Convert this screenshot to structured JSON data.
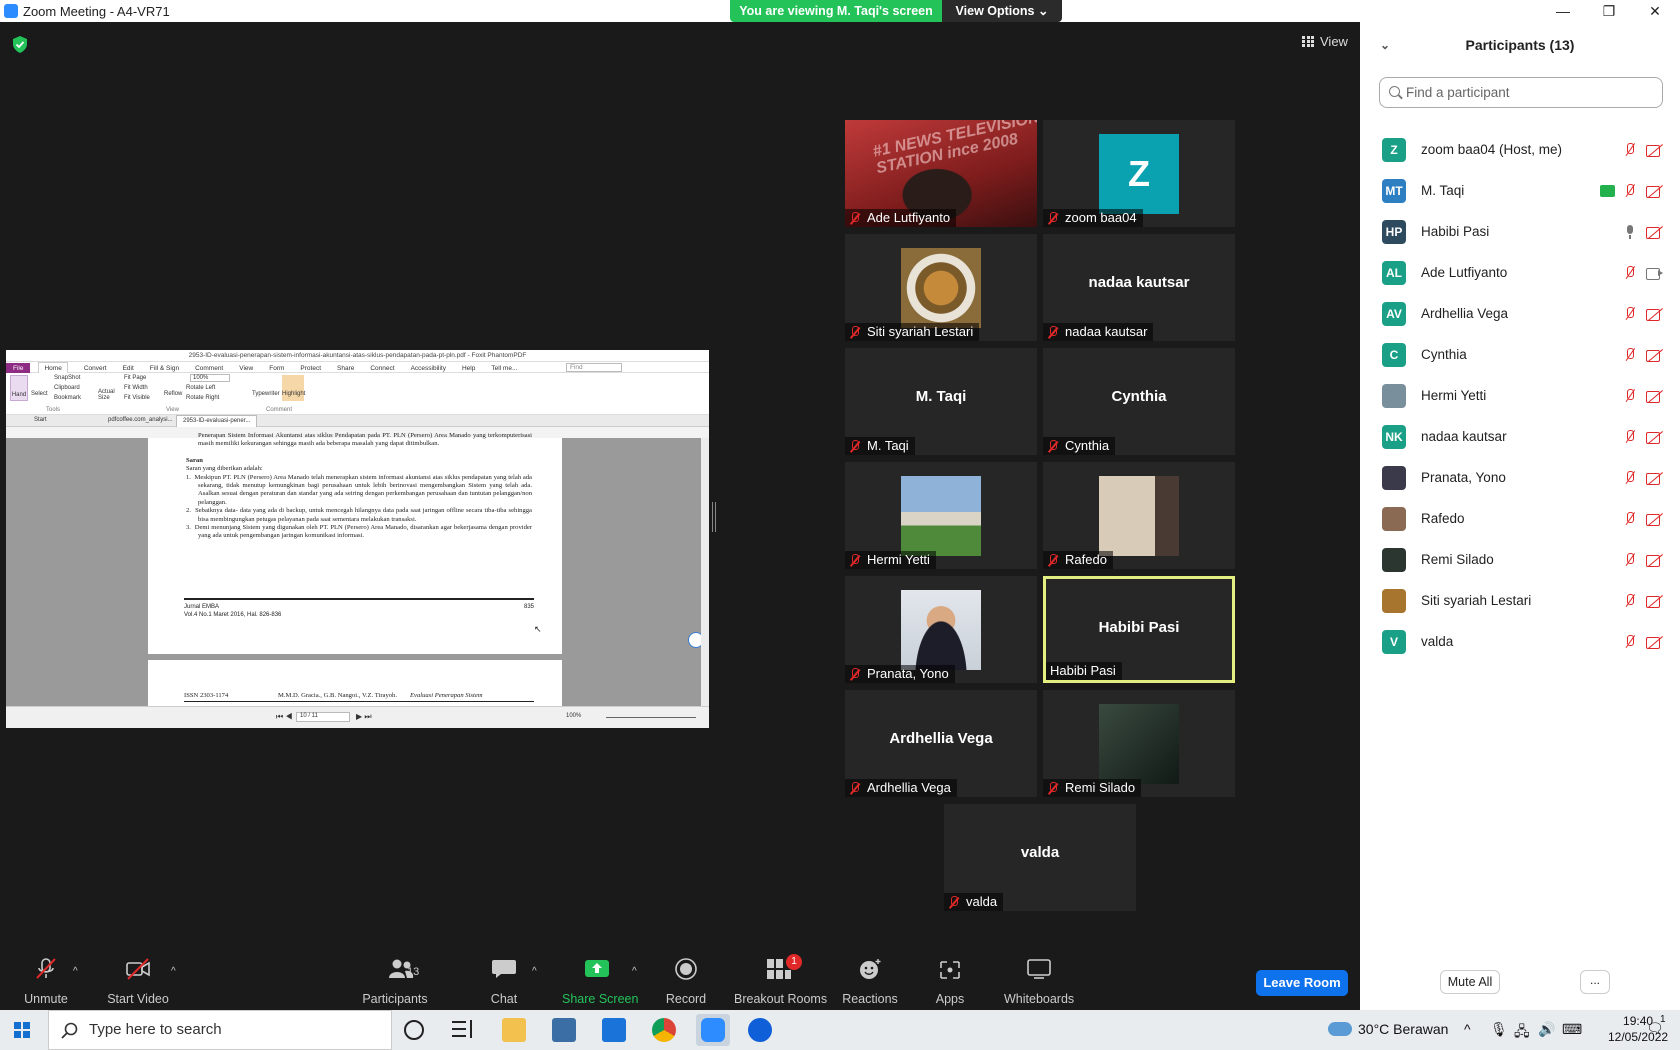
{
  "window": {
    "title": "Zoom Meeting - A4-VR71",
    "minimize": "—",
    "maximize": "❐",
    "close": "✕"
  },
  "banner": {
    "viewing": "You are viewing M. Taqi's screen",
    "view_options": "View Options ⌄"
  },
  "view_button": "View",
  "shared_screen": {
    "title": "2953-ID-evaluasi-penerapan-sistem-informasi-akuntansi-atas-siklus-pendapatan-pada-pt-pln.pdf - Foxit PhantomPDF",
    "menu": [
      "File",
      "Home",
      "Convert",
      "Edit",
      "Fill & Sign",
      "Comment",
      "View",
      "Form",
      "Protect",
      "Share",
      "Connect",
      "Accessibility",
      "Help",
      "Tell me..."
    ],
    "find_placeholder": "Find",
    "ribbon": {
      "hand": "Hand",
      "select": "Select",
      "snapshot": "SnapShot",
      "clipboard": "Clipboard",
      "bookmark": "Bookmark",
      "actual_size": "Actual Size",
      "fit_page": "Fit Page",
      "fit_width": "Fit Width",
      "fit_visible": "Fit Visible",
      "reflow": "Reflow",
      "zoom": "100%",
      "rotate_left": "Rotate Left",
      "rotate_right": "Rotate Right",
      "typewriter": "Typewriter",
      "highlight": "Highlight",
      "group_tools": "Tools",
      "group_view": "View",
      "group_comment": "Comment"
    },
    "doc_tabs": [
      "Start",
      "pdfcoffee.com_analysi...",
      "2953-ID-evaluasi-pener..."
    ],
    "page_text": {
      "partial_top": "Penerapan Sistem Informasi Akuntansi atas siklus Pendapatan pada PT. PLN (Persero) Area Manado yang terkomputerisasi masih memiliki kekurangan sehingga masih ada beberapa masalah yang dapat ditimbulkan.",
      "heading": "Saran",
      "intro": "Saran yang diberikan adalah:",
      "items": [
        "Meskipun PT. PLN (Persero) Area Manado telah menerapkan sistem informasi akuntansi atas siklus pendapatan yang telah ada sekarang, tidak menutup kemungkinan bagi perusahaan untuk lebih berinovasi mengembangkan Sistem yang telah ada. Asalkan sesuai dengan peraturan dan standar yang ada seiring dengan perkembangan perusahaan dan tuntutan pelanggan/non pelanggan.",
        "Sebaiknya data- data yang ada di backup, untuk mencegah hilangnya data pada saat jaringan offline secara tiba-tiba sehingga bisa membingungkan petugas pelayanan pada saat sementara melakukan transaksi.",
        "Demi menunjang Sistem yang digunakan oleh PT. PLN (Persero) Area Manado, disarankan agar bekerjasama dengan provider yang ada untuk pengembangan jaringan komunikasi informasi."
      ],
      "footer_journal": "Jurnal EMBA",
      "footer_vol": "Vol.4 No.1 Maret 2016, Hal. 826-836",
      "footer_page": "835",
      "next_issn": "ISSN 2303-1174",
      "next_authors": "M.M.D. Gracia., G.B. Nangoi., V.Z. Tirayoh.",
      "next_title": "Evaluasi Penerapan Sistem"
    },
    "page_nav": "10 / 11",
    "zoom_status": "100%"
  },
  "tiles": [
    {
      "name": "Ade Lutfiyanto",
      "type": "video"
    },
    {
      "name": "zoom baa04",
      "type": "avatar",
      "initial": "Z"
    },
    {
      "name": "Siti syariah Lestari",
      "type": "photo"
    },
    {
      "name": "nadaa kautsar",
      "type": "text"
    },
    {
      "name": "M. Taqi",
      "type": "text"
    },
    {
      "name": "Cynthia",
      "type": "text"
    },
    {
      "name": "Hermi Yetti",
      "type": "photo"
    },
    {
      "name": "Rafedo",
      "type": "photo"
    },
    {
      "name": "Pranata, Yono",
      "type": "photo"
    },
    {
      "name": "Habibi Pasi",
      "type": "text",
      "active": true
    },
    {
      "name": "Ardhellia Vega",
      "type": "text"
    },
    {
      "name": "Remi Silado",
      "type": "photo"
    },
    {
      "name": "valda",
      "type": "text"
    }
  ],
  "video_overlay_text": "#1 NEWS TELEVISION STATION  ince 2008",
  "participants_panel": {
    "title": "Participants (13)",
    "search_placeholder": "Find a participant",
    "list": [
      {
        "initials": "Z",
        "name": "zoom baa04 (Host, me)",
        "color": "#1aa087",
        "mic": "muted",
        "cam": "off"
      },
      {
        "initials": "MT",
        "name": "M. Taqi",
        "color": "#2d7fc1",
        "mic": "muted",
        "cam": "off",
        "sharing": true
      },
      {
        "initials": "HP",
        "name": "Habibi Pasi",
        "color": "#2d4a5f",
        "mic": "on",
        "cam": "off"
      },
      {
        "initials": "AL",
        "name": "Ade Lutfiyanto",
        "color": "#1aa087",
        "mic": "muted",
        "cam": "on"
      },
      {
        "initials": "AV",
        "name": "Ardhellia Vega",
        "color": "#1aa087",
        "mic": "muted",
        "cam": "off"
      },
      {
        "initials": "C",
        "name": "Cynthia",
        "color": "#1aa087",
        "mic": "muted",
        "cam": "off"
      },
      {
        "initials": "",
        "name": "Hermi Yetti",
        "color": "#7a8f9c",
        "mic": "muted",
        "cam": "off",
        "photo": true
      },
      {
        "initials": "NK",
        "name": "nadaa kautsar",
        "color": "#1aa087",
        "mic": "muted",
        "cam": "off"
      },
      {
        "initials": "",
        "name": "Pranata, Yono",
        "color": "#3a3a4a",
        "mic": "muted",
        "cam": "off",
        "photo": true
      },
      {
        "initials": "",
        "name": "Rafedo",
        "color": "#8a6a52",
        "mic": "muted",
        "cam": "off",
        "photo": true
      },
      {
        "initials": "",
        "name": "Remi Silado",
        "color": "#2b3630",
        "mic": "muted",
        "cam": "off",
        "photo": true
      },
      {
        "initials": "",
        "name": "Siti syariah Lestari",
        "color": "#a8752e",
        "mic": "muted",
        "cam": "off",
        "photo": true
      },
      {
        "initials": "V",
        "name": "valda",
        "color": "#1aa087",
        "mic": "muted",
        "cam": "off"
      }
    ],
    "mute_all": "Mute All",
    "more": "..."
  },
  "toolbar": {
    "unmute": "Unmute",
    "start_video": "Start Video",
    "participants": "Participants",
    "participants_count": "13",
    "chat": "Chat",
    "share_screen": "Share Screen",
    "record": "Record",
    "breakout_rooms": "Breakout Rooms",
    "breakout_badge": "1",
    "reactions": "Reactions",
    "apps": "Apps",
    "whiteboards": "Whiteboards",
    "leave": "Leave Room"
  },
  "taskbar": {
    "search_placeholder": "Type here to search",
    "weather": "30°C  Berawan",
    "time": "19:40",
    "date": "12/05/2022",
    "notifications": "1"
  },
  "colors": {
    "share_green": "#23c35a",
    "active_border": "#e4ef82",
    "leave_blue": "#0e72ed",
    "muted_red": "#e02828"
  }
}
